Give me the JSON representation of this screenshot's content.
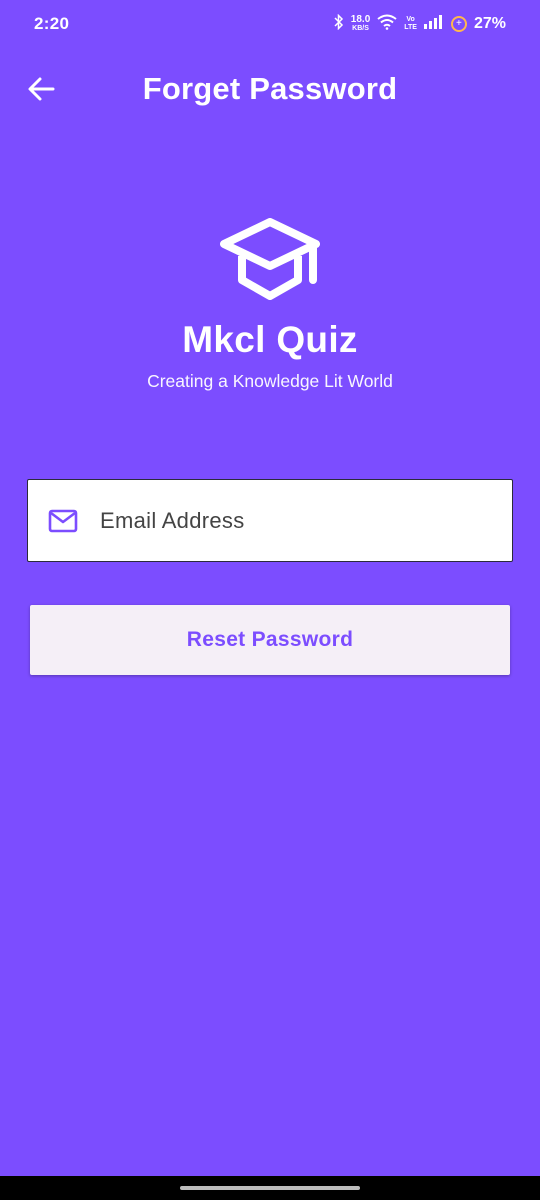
{
  "status_bar": {
    "time": "2:20",
    "net_speed_value": "18.0",
    "net_speed_unit": "KB/S",
    "volte_top": "Vo",
    "volte_bottom": "LTE",
    "battery_ring_symbol": "+",
    "battery_percent": "27%"
  },
  "app_bar": {
    "title": "Forget Password",
    "back_icon": "arrow-back-icon"
  },
  "logo": {
    "icon": "graduation-cap-icon",
    "app_name": "Mkcl Quiz",
    "tagline": "Creating a Knowledge Lit World"
  },
  "form": {
    "email_icon": "mail-icon",
    "email_placeholder": "Email Address",
    "email_value": "",
    "reset_button_label": "Reset Password"
  },
  "colors": {
    "background": "#7c4dff",
    "accent": "#7c4dff",
    "button_bg": "#f5eff7",
    "field_bg": "#ffffff"
  }
}
